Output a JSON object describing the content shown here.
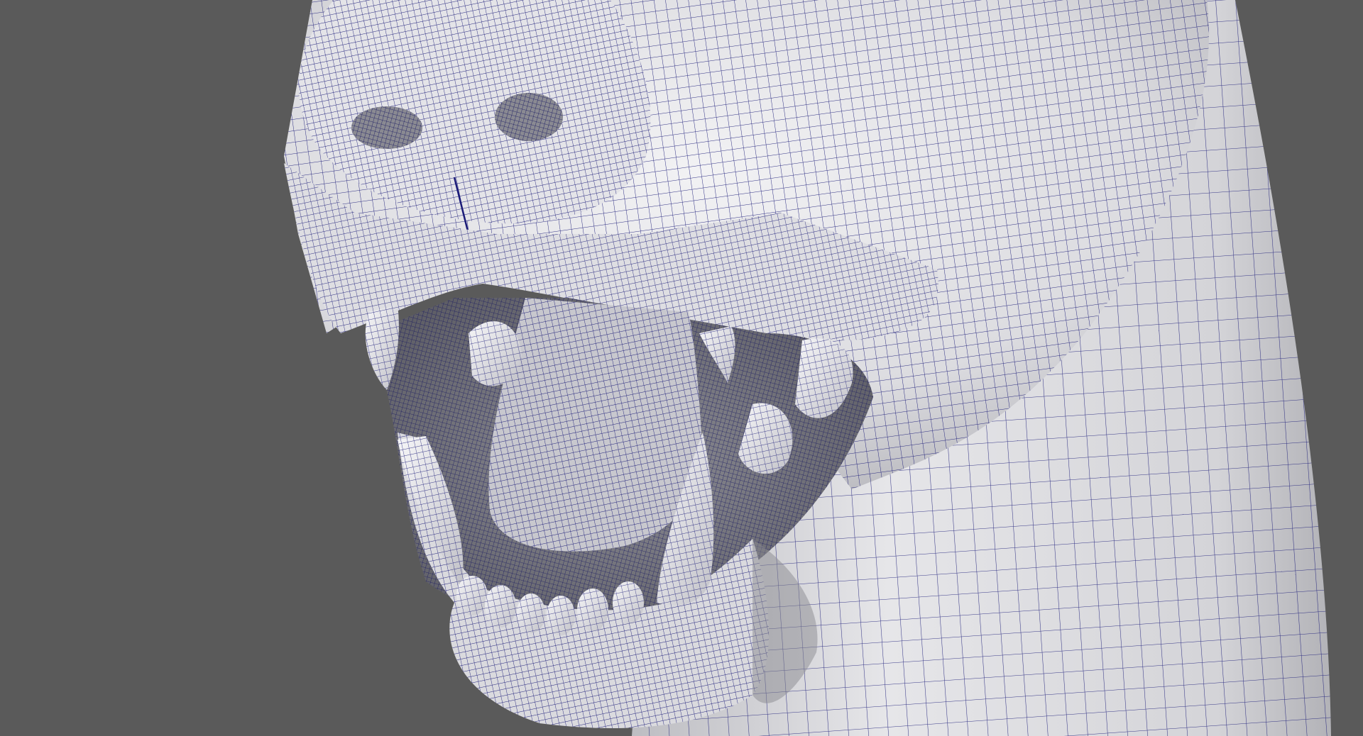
{
  "viewport": {
    "background_color": "#5a5a5a",
    "display_mode": "wireframe-on-shaded"
  },
  "model": {
    "subject": "dog-head-snarling",
    "surface_color": "#e8e8ea",
    "shadow_color": "#9a9aa0",
    "wireframe_color": "#14146e"
  }
}
